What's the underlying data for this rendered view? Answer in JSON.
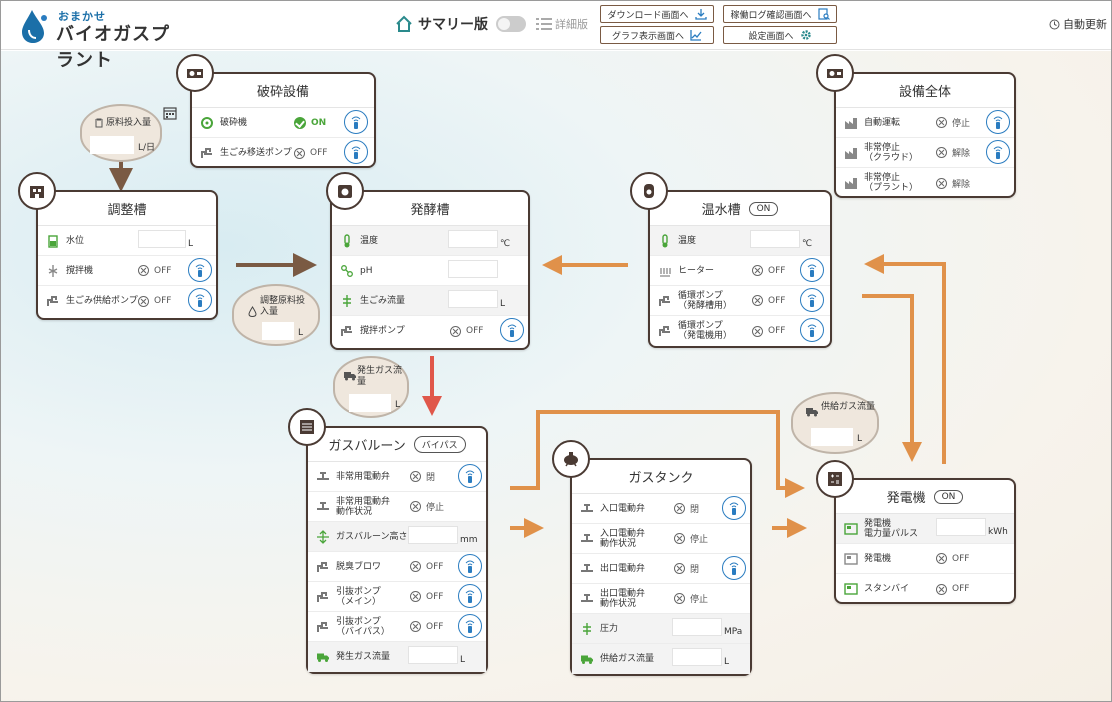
{
  "header": {
    "logo_sub": "おまかせ",
    "logo_main": "バイオガスプラント",
    "mode_summary": "サマリー版",
    "mode_detail": "詳細版",
    "btn_download": "ダウンロード画面へ",
    "btn_graph": "グラフ表示画面へ",
    "btn_log": "稼働ログ確認画面へ",
    "btn_settings": "設定画面へ",
    "auto_refresh": "自動更新"
  },
  "bubbles": {
    "raw_input": {
      "label": "原料投入量",
      "unit": "L/日"
    },
    "adjusted_input": {
      "label": "調整原料投入量",
      "unit": "L"
    },
    "generated_gas": {
      "label": "発生ガス流量",
      "unit": "L"
    },
    "supply_gas": {
      "label": "供給ガス流量",
      "unit": "L"
    }
  },
  "crusher": {
    "title": "破砕設備",
    "rows": [
      {
        "label": "破砕機",
        "status": "ON"
      },
      {
        "label": "生ごみ移送ポンプ",
        "status": "OFF"
      }
    ]
  },
  "adjust_tank": {
    "title": "調整槽",
    "rows": [
      {
        "label": "水位",
        "unit": "L"
      },
      {
        "label": "撹拌機",
        "status": "OFF"
      },
      {
        "label": "生ごみ供給ポンプ",
        "status": "OFF"
      }
    ]
  },
  "fermentation": {
    "title": "発酵槽",
    "rows": [
      {
        "label": "温度",
        "unit": "℃"
      },
      {
        "label": "pH",
        "unit": ""
      },
      {
        "label": "生ごみ流量",
        "unit": "L"
      },
      {
        "label": "撹拌ポンプ",
        "status": "OFF"
      }
    ]
  },
  "hot_water": {
    "title": "温水槽",
    "badge": "ON",
    "rows": [
      {
        "label": "温度",
        "unit": "℃"
      },
      {
        "label": "ヒーター",
        "status": "OFF"
      },
      {
        "label": "循環ポンプ\n（発酵槽用）",
        "status": "OFF"
      },
      {
        "label": "循環ポンプ\n（発電機用）",
        "status": "OFF"
      }
    ]
  },
  "facility": {
    "title": "設備全体",
    "rows": [
      {
        "label": "自動運転",
        "status": "停止"
      },
      {
        "label": "非常停止\n（クラウド）",
        "status": "解除"
      },
      {
        "label": "非常停止\n（プラント）",
        "status": "解除"
      }
    ]
  },
  "balloon": {
    "title": "ガスバルーン",
    "badge": "バイパス",
    "rows": [
      {
        "label": "非常用電動弁",
        "status": "閉"
      },
      {
        "label": "非常用電動弁\n動作状況",
        "status": "停止"
      },
      {
        "label": "ガスバルーン高さ",
        "unit": "mm"
      },
      {
        "label": "脱臭ブロワ",
        "status": "OFF"
      },
      {
        "label": "引抜ポンプ\n（メイン）",
        "status": "OFF"
      },
      {
        "label": "引抜ポンプ\n（バイパス）",
        "status": "OFF"
      },
      {
        "label": "発生ガス流量",
        "unit": "L"
      }
    ]
  },
  "gas_tank": {
    "title": "ガスタンク",
    "rows": [
      {
        "label": "入口電動弁",
        "status": "閉"
      },
      {
        "label": "入口電動弁\n動作状況",
        "status": "停止"
      },
      {
        "label": "出口電動弁",
        "status": "閉"
      },
      {
        "label": "出口電動弁\n動作状況",
        "status": "停止"
      },
      {
        "label": "圧力",
        "unit": "MPa"
      },
      {
        "label": "供給ガス流量",
        "unit": "L"
      }
    ]
  },
  "generator": {
    "title": "発電機",
    "badge": "ON",
    "rows": [
      {
        "label": "発電機\n電力量パルス",
        "unit": "kWh"
      },
      {
        "label": "発電機",
        "status": "OFF"
      },
      {
        "label": "スタンバイ",
        "status": "OFF"
      }
    ]
  },
  "colors": {
    "card_border": "#4a3a33",
    "on_green": "#4aa53a",
    "remote_blue": "#2a7cc0",
    "arrow_orange": "#e0914a",
    "arrow_red": "#e0574a",
    "arrow_brown": "#7a5a43"
  }
}
